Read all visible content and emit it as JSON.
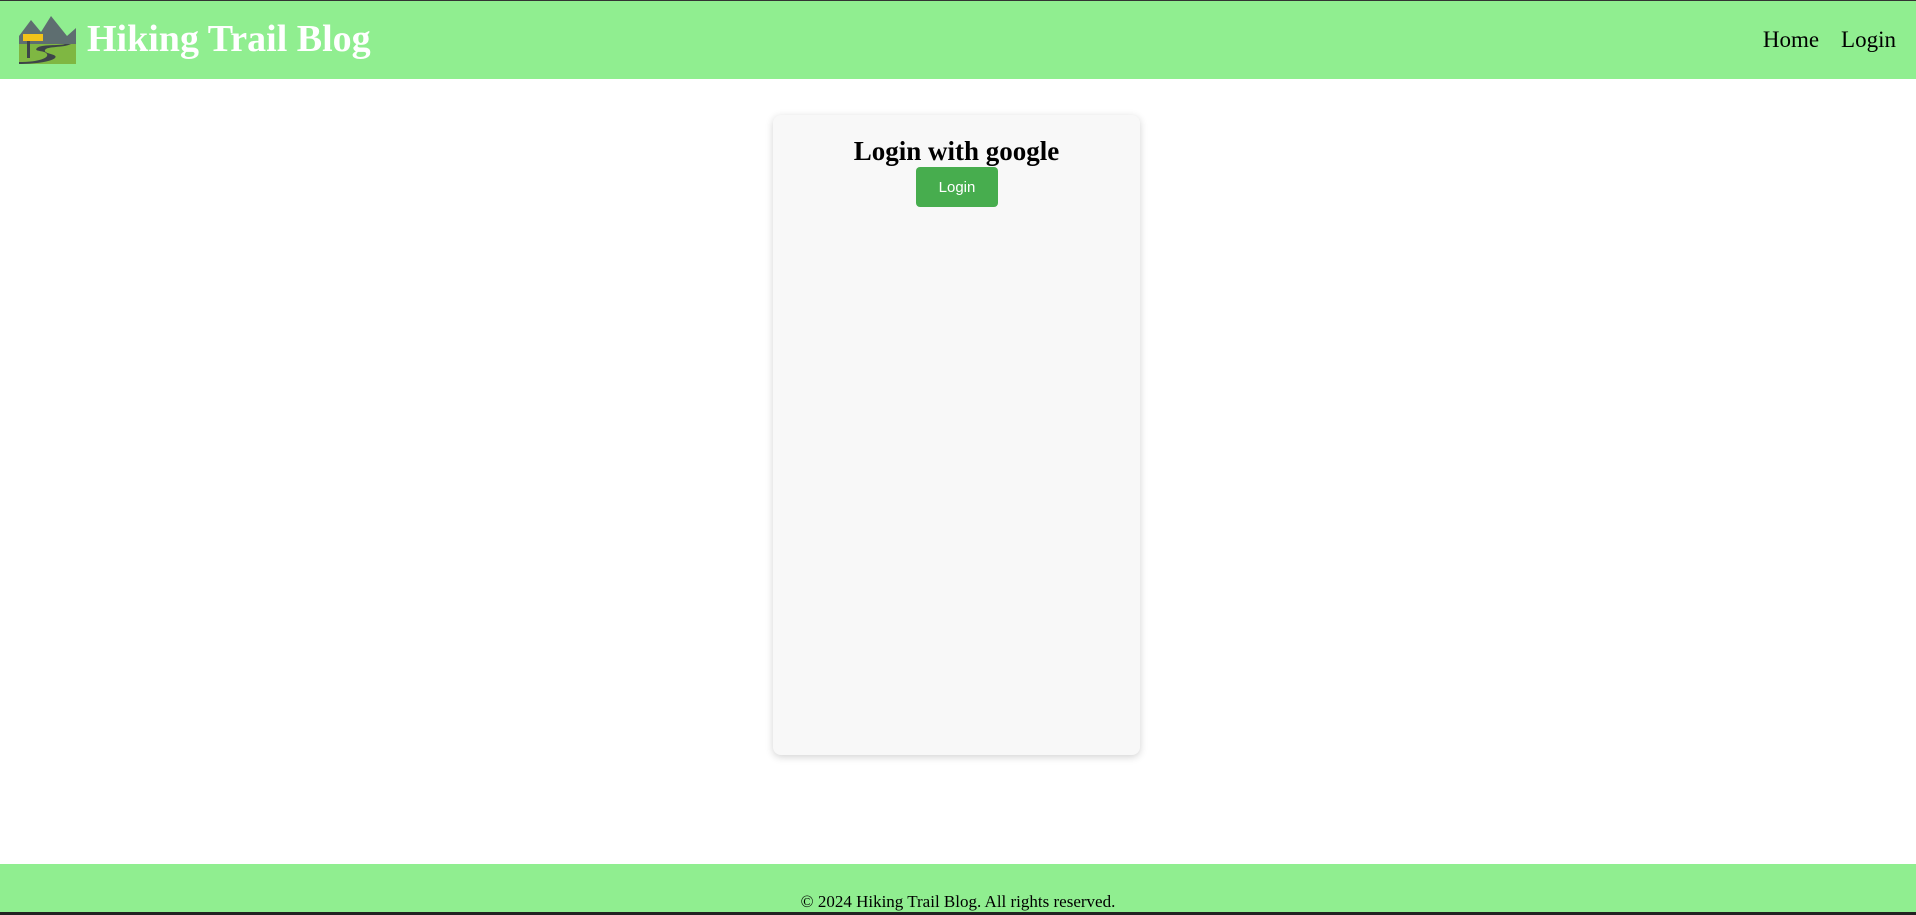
{
  "header": {
    "logo_icon": "mountain-trail-icon",
    "title": "Hiking Trail Blog",
    "nav": [
      {
        "label": "Home"
      },
      {
        "label": "Login"
      }
    ],
    "background_color": "#90ee90"
  },
  "login_card": {
    "heading": "Login with google",
    "button_label": "Login",
    "button_color": "#47ad4e"
  },
  "footer": {
    "text": "© 2024 Hiking Trail Blog. All rights reserved."
  }
}
